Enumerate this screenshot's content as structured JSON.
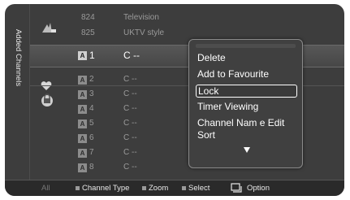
{
  "sidebar": {
    "label": "Added Channels",
    "sections": [
      {
        "icon": "antenna-icon"
      },
      {
        "icon": "edit-icon"
      },
      {
        "icon": "heart-icon"
      },
      {
        "icon": "lock-icon"
      }
    ]
  },
  "channels_top": [
    {
      "number": "824",
      "name": "Television"
    },
    {
      "number": "825",
      "name": "UKTV style"
    }
  ],
  "channels": [
    {
      "badge": "A",
      "number": "1",
      "name": "C --",
      "selected": true
    },
    {
      "badge": "A",
      "number": "2",
      "name": "C --"
    },
    {
      "badge": "A",
      "number": "3",
      "name": "C --"
    },
    {
      "badge": "A",
      "number": "4",
      "name": "C --"
    },
    {
      "badge": "A",
      "number": "5",
      "name": "C --"
    },
    {
      "badge": "A",
      "number": "6",
      "name": "C --"
    },
    {
      "badge": "A",
      "number": "7",
      "name": "C --"
    },
    {
      "badge": "A",
      "number": "8",
      "name": "C --"
    }
  ],
  "popup_menu": {
    "items": [
      "Delete",
      "Add to Favourite",
      "Lock",
      "Timer Viewing",
      "Channel Nam e Edit",
      "Sort"
    ],
    "highlighted": "Lock",
    "more_indicator": "down-arrow-icon"
  },
  "bottom_bar": {
    "all": "All",
    "channel_type": "Channel Type",
    "zoom": "Zoom",
    "select": "Select",
    "option": "Option"
  },
  "colors": {
    "background": "#3d3d3d",
    "highlight_row": "#505050",
    "popup_border": "#8a8a8a",
    "text_dim": "#9a9a9a",
    "text_bright": "#ffffff"
  }
}
